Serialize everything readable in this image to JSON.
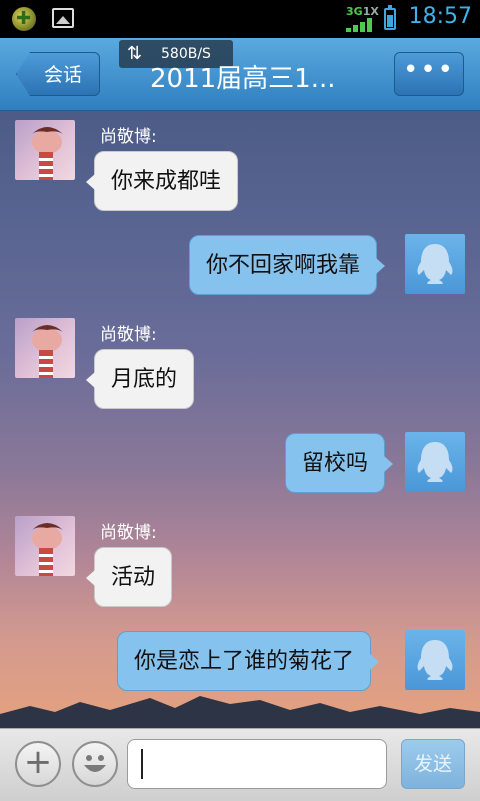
{
  "status_bar": {
    "network": "3G",
    "network_extra": "1X",
    "time": "18:57",
    "icons": [
      "app-notification-icon",
      "image-notification-icon",
      "signal-icon",
      "battery-icon"
    ]
  },
  "header": {
    "back_label": "会话",
    "traffic_rate": "580B/S",
    "traffic_arrows": "⇅",
    "title": "2011届高三1...",
    "more_label": "•••"
  },
  "messages": [
    {
      "side": "left",
      "sender": "尚敬博:",
      "text": "你来成都哇"
    },
    {
      "side": "right",
      "text": "你不回家啊我靠"
    },
    {
      "side": "left",
      "sender": "尚敬博:",
      "text": "月底的"
    },
    {
      "side": "right",
      "text": "留校吗"
    },
    {
      "side": "left",
      "sender": "尚敬博:",
      "text": "活动"
    },
    {
      "side": "right",
      "text": "你是恋上了谁的菊花了"
    }
  ],
  "input_bar": {
    "plus_label": "+",
    "input_value": "",
    "send_label": "发送"
  },
  "colors": {
    "header_top": "#5aa9df",
    "header_bottom": "#2f7fc0",
    "bubble_right": "#86c2ee",
    "bubble_left": "#f2f2f2",
    "time_color": "#3eb2ec"
  }
}
